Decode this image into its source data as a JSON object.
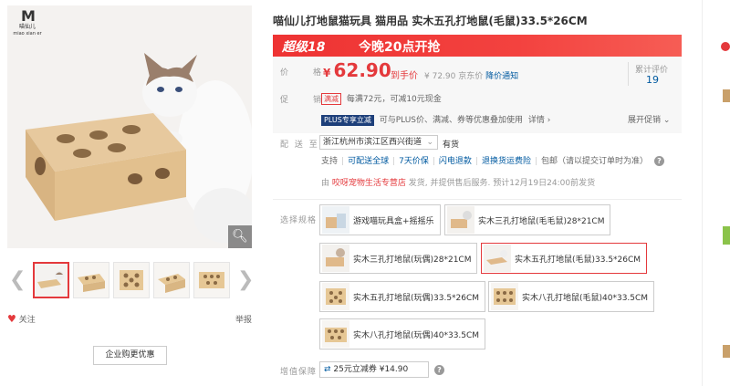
{
  "brand": {
    "logo_cn": "喵仙儿",
    "logo_en": "miao xian er"
  },
  "gallery": {
    "follow_label": "关注",
    "report_label": "举报",
    "enterprise_button": "企业购更优惠"
  },
  "product": {
    "title": "喵仙儿打地鼠猫玩具 猫用品 实木五孔打地鼠(毛鼠)33.5*26CM",
    "promo_banner": {
      "tag": "超级18",
      "text": "今晚20点开抢"
    },
    "price_label": "价　格",
    "currency": "¥",
    "price": "62.90",
    "paid_label": "到手价",
    "jd_price": "¥ 72.90",
    "jd_price_label": "京东价",
    "price_notice": "降价通知",
    "review_label": "累计评价",
    "review_count": "19",
    "promo_label": "促　销",
    "promo_tag": "满减",
    "promo_text": "每满72元，可减10元现金",
    "plus_tag": "PLUS专享立减",
    "plus_text": "可与PLUS价、满减、券等优惠叠加使用",
    "plus_more": "详情 ›",
    "expand_promo": "展开促销",
    "delivery_label": "配 送 至",
    "address": "浙江杭州市滨江区西兴街道",
    "stock": "有货",
    "services": [
      "支持",
      "可配送全球",
      "7天价保",
      "闪电退款",
      "退换货运费险",
      "包邮（请以提交订单时为准）"
    ],
    "shipper_prefix": "由",
    "shipper": "咬呀宠物生活专营店",
    "ship_text": "发货, 并提供售后服务. 预计12月19日24:00前发货",
    "spec_label": "选择规格",
    "options": [
      "游戏喵玩具盒+摇摇乐",
      "实木三孔打地鼠(毛毛鼠)28*21CM",
      "实木三孔打地鼠(玩偶)28*21CM",
      "实木五孔打地鼠(毛鼠)33.5*26CM",
      "实木五孔打地鼠(玩偶)33.5*26CM",
      "实木八孔打地鼠(毛鼠)40*33.5CM",
      "实木八孔打地鼠(玩偶)40*33.5CM"
    ],
    "selected_option": 3,
    "value_label": "增值保障",
    "value_service": "25元立减券 ¥14.90"
  },
  "colors": {
    "accent": "#e4393c",
    "link": "#005aa0",
    "plus": "#1d3f7a"
  }
}
